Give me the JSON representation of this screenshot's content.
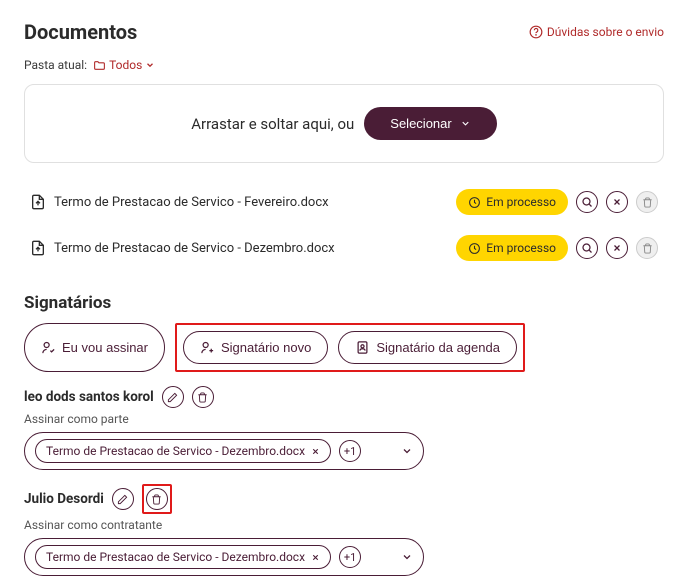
{
  "header": {
    "title": "Documentos",
    "help_label": "Dúvidas sobre o envio"
  },
  "breadcrumb": {
    "label": "Pasta atual:",
    "folder": "Todos"
  },
  "dropzone": {
    "text": "Arrastar e soltar aqui, ou",
    "button": "Selecionar"
  },
  "files": [
    {
      "name": "Termo de Prestacao de Servico - Fevereiro.docx",
      "status": "Em processo"
    },
    {
      "name": "Termo de Prestacao de Servico - Dezembro.docx",
      "status": "Em processo"
    }
  ],
  "signatories": {
    "title": "Signatários",
    "actions": {
      "self_sign": "Eu vou assinar",
      "new_signatory": "Signatário novo",
      "from_agenda": "Signatário da agenda"
    },
    "list": [
      {
        "name": "leo dods santos korol",
        "role": "Assinar como parte",
        "selected_doc": "Termo de Prestacao de Servico - Dezembro.docx",
        "extra_count": "+1"
      },
      {
        "name": "Julio Desordi",
        "role": "Assinar como contratante",
        "selected_doc": "Termo de Prestacao de Servico - Dezembro.docx",
        "extra_count": "+1"
      }
    ]
  }
}
